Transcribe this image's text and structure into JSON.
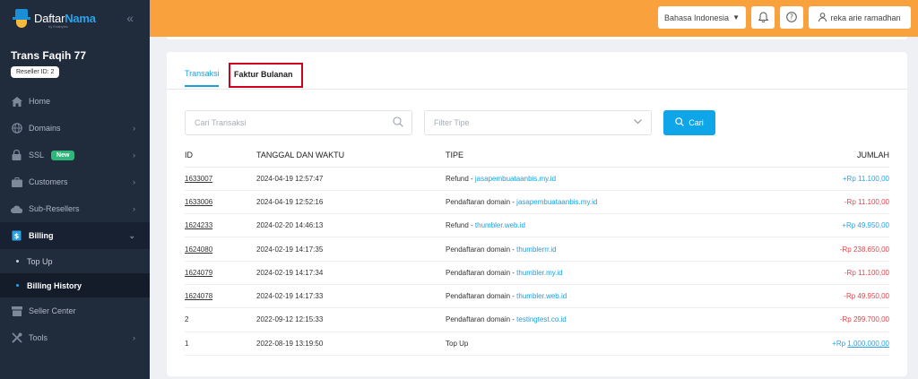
{
  "sidebar": {
    "logo_left": "Daftar",
    "logo_right": "Nama",
    "logo_sub": "by Exabytes",
    "collapse_icon": "double-chevron-left-icon",
    "account_name": "Trans Faqih 77",
    "reseller_label": "Reseller ID: 2",
    "nav": [
      {
        "label": "Home",
        "icon": "home-icon"
      },
      {
        "label": "Domains",
        "icon": "globe-icon"
      },
      {
        "label": "SSL",
        "icon": "lock-icon",
        "badge": "New"
      },
      {
        "label": "Customers",
        "icon": "briefcase-icon"
      },
      {
        "label": "Sub-Resellers",
        "icon": "cloud-icon"
      },
      {
        "label": "Billing",
        "icon": "invoice-icon"
      },
      {
        "label": "Top Up"
      },
      {
        "label": "Billing History"
      },
      {
        "label": "Seller Center",
        "icon": "store-icon"
      },
      {
        "label": "Tools",
        "icon": "tools-icon"
      }
    ]
  },
  "header": {
    "language": "Bahasa Indonesia",
    "user": "reka arie ramadhan"
  },
  "tabs": {
    "transaksi": "Transaksi",
    "faktur": "Faktur Bulanan"
  },
  "filters": {
    "search_placeholder": "Cari Transaksi",
    "type_placeholder": "Filter Tipe",
    "search_button": "Cari"
  },
  "table": {
    "headers": {
      "id": "ID",
      "datetime": "TANGGAL DAN WAKTU",
      "type": "TIPE",
      "amount": "JUMLAH"
    },
    "rows": [
      {
        "id": "1633007",
        "datetime": "2024-04-19 12:57:47",
        "type": "Refund",
        "domain": "jasapembuataanbis.my.id",
        "amount": "+Rp 11.100,00"
      },
      {
        "id": "1633006",
        "datetime": "2024-04-19 12:52:16",
        "type": "Pendaftaran domain",
        "domain": "jasapembuataanbis.my.id",
        "amount": "-Rp 11.100,00"
      },
      {
        "id": "1624233",
        "datetime": "2024-02-20 14:46:13",
        "type": "Refund",
        "domain": "thumbler.web.id",
        "amount": "+Rp 49.950,00"
      },
      {
        "id": "1624080",
        "datetime": "2024-02-19 14:17:35",
        "type": "Pendaftaran domain",
        "domain": "thumblerrr.id",
        "amount": "-Rp 238.650,00"
      },
      {
        "id": "1624079",
        "datetime": "2024-02-19 14:17:34",
        "type": "Pendaftaran domain",
        "domain": "thumbler.my.id",
        "amount": "-Rp 11.100,00"
      },
      {
        "id": "1624078",
        "datetime": "2024-02-19 14:17:33",
        "type": "Pendaftaran domain",
        "domain": "thumbler.web.id",
        "amount": "-Rp 49.950,00"
      },
      {
        "id": "2",
        "datetime": "2022-09-12 12:15:33",
        "type": "Pendaftaran domain",
        "domain": "testingtest.co.id",
        "amount": "-Rp 299.700,00"
      },
      {
        "id": "1",
        "datetime": "2022-08-19 13:19:50",
        "type": "Top Up",
        "domain": "",
        "amount_prefix": "+Rp",
        "amount_value": "1.000.000,00"
      }
    ]
  },
  "colors": {
    "header_bg": "#f9a13c",
    "sidebar_bg": "#202b3c",
    "accent": "#1aa0e0",
    "positive": "#2aa3e8",
    "negative": "#e4444c",
    "highlight_box": "#d0021b"
  }
}
